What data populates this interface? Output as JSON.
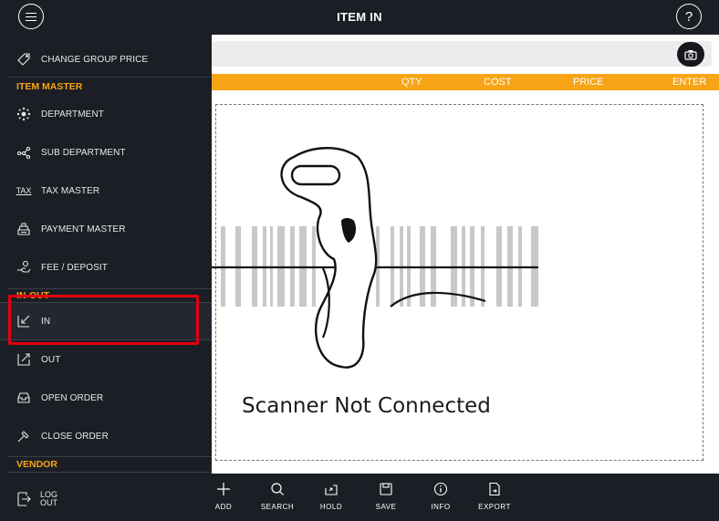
{
  "header": {
    "title": "ITEM IN",
    "help_label": "?"
  },
  "columns": [
    "QTY",
    "COST",
    "PRICE",
    "ENTER"
  ],
  "scanner": {
    "message": "Scanner Not Connected"
  },
  "toolbar": [
    {
      "label": "ADD",
      "icon": "plus-icon"
    },
    {
      "label": "SEARCH",
      "icon": "search-icon"
    },
    {
      "label": "HOLD",
      "icon": "hold-icon"
    },
    {
      "label": "SAVE",
      "icon": "save-icon"
    },
    {
      "label": "INFO",
      "icon": "info-icon"
    },
    {
      "label": "EXPORT",
      "icon": "export-icon"
    }
  ],
  "sidemenu": {
    "change_group_price": "CHANGE GROUP PRICE",
    "section_item_master": "ITEM MASTER",
    "department": "DEPARTMENT",
    "sub_department": "SUB DEPARTMENT",
    "tax_master": "TAX MASTER",
    "tax_icon_text": "TAX",
    "payment_master": "PAYMENT MASTER",
    "fee_deposit": "FEE / DEPOSIT",
    "section_in_out": "IN-OUT",
    "in": "IN",
    "out": "OUT",
    "open_order": "OPEN ORDER",
    "close_order": "CLOSE ORDER",
    "section_vendor": "VENDOR",
    "log": "LOG",
    "out_word": "OUT"
  },
  "colors": {
    "accent": "#f7a416",
    "dark": "#1b1e24",
    "highlight": "#e3000f"
  }
}
